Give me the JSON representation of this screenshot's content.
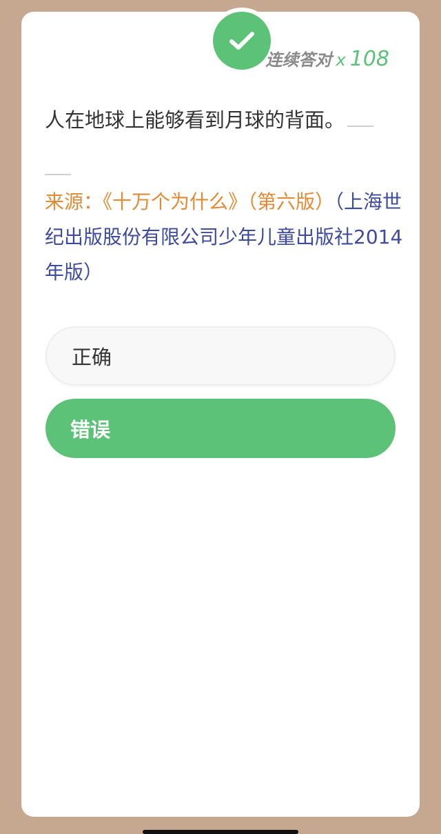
{
  "streak": {
    "label": "连续答对",
    "multiplier": "x",
    "count": "108"
  },
  "question": {
    "text": "人在地球上能够看到月球的背面。"
  },
  "source": {
    "label": "来源：",
    "book": "《十万个为什么》（第六版）",
    "publisher": "（上海世纪出版股份有限公司少年儿童出版社2014年版）"
  },
  "options": [
    {
      "label": "正确",
      "selected": false
    },
    {
      "label": "错误",
      "selected": true
    }
  ],
  "colors": {
    "accent_green": "#5cc277",
    "source_orange": "#e28a34",
    "source_blue": "#3d4b9c",
    "background": "#c6a78f"
  },
  "icons": {
    "badge": "check-icon"
  }
}
